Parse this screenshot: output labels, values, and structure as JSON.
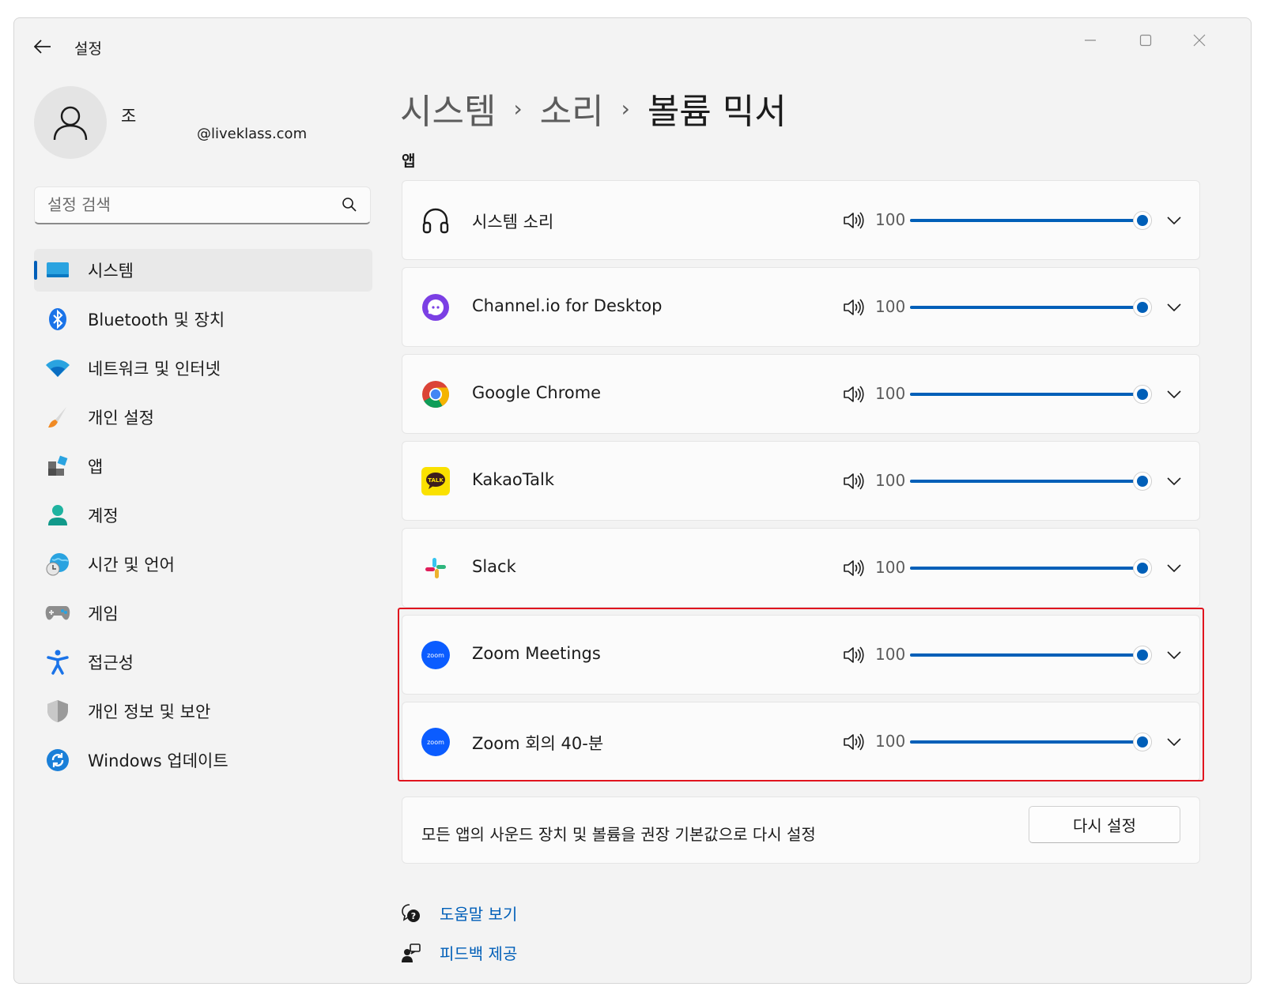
{
  "window": {
    "title": "설정",
    "controls": [
      "minimize",
      "maximize",
      "close"
    ]
  },
  "profile": {
    "name": "조",
    "email": "@liveklass.com"
  },
  "search": {
    "placeholder": "설정 검색"
  },
  "sidebar": {
    "items": [
      {
        "label": "시스템",
        "icon": "system-icon",
        "active": true
      },
      {
        "label": "Bluetooth 및 장치",
        "icon": "bluetooth-icon"
      },
      {
        "label": "네트워크 및 인터넷",
        "icon": "wifi-icon"
      },
      {
        "label": "개인 설정",
        "icon": "brush-icon"
      },
      {
        "label": "앱",
        "icon": "apps-icon"
      },
      {
        "label": "계정",
        "icon": "account-icon"
      },
      {
        "label": "시간 및 언어",
        "icon": "globe-clock-icon"
      },
      {
        "label": "게임",
        "icon": "gamepad-icon"
      },
      {
        "label": "접근성",
        "icon": "accessibility-icon"
      },
      {
        "label": "개인 정보 및 보안",
        "icon": "shield-icon"
      },
      {
        "label": "Windows 업데이트",
        "icon": "update-icon"
      }
    ]
  },
  "breadcrumb": {
    "items": [
      "시스템",
      "소리",
      "볼륨 믹서"
    ],
    "separator": "›"
  },
  "apps_section": {
    "label": "앱",
    "apps": [
      {
        "name": "시스템 소리",
        "icon": "headphones-icon",
        "volume": 100
      },
      {
        "name": "Channel.io for Desktop",
        "icon": "channelio-icon",
        "volume": 100
      },
      {
        "name": "Google Chrome",
        "icon": "chrome-icon",
        "volume": 100
      },
      {
        "name": "KakaoTalk",
        "icon": "kakaotalk-icon",
        "volume": 100
      },
      {
        "name": "Slack",
        "icon": "slack-icon",
        "volume": 100
      },
      {
        "name": "Zoom Meetings",
        "icon": "zoom-icon",
        "volume": 100
      },
      {
        "name": "Zoom 회의 40-분",
        "icon": "zoom-icon",
        "volume": 100
      }
    ]
  },
  "reset": {
    "text": "모든 앱의 사운드 장치 및 볼륨을 권장 기본값으로 다시 설정",
    "button_label": "다시 설정"
  },
  "footer": {
    "help_label": "도움말 보기",
    "feedback_label": "피드백 제공"
  },
  "colors": {
    "accent": "#005fb8",
    "highlight_border": "#e0141e",
    "background": "#f3f3f3",
    "card": "#fbfbfb"
  }
}
